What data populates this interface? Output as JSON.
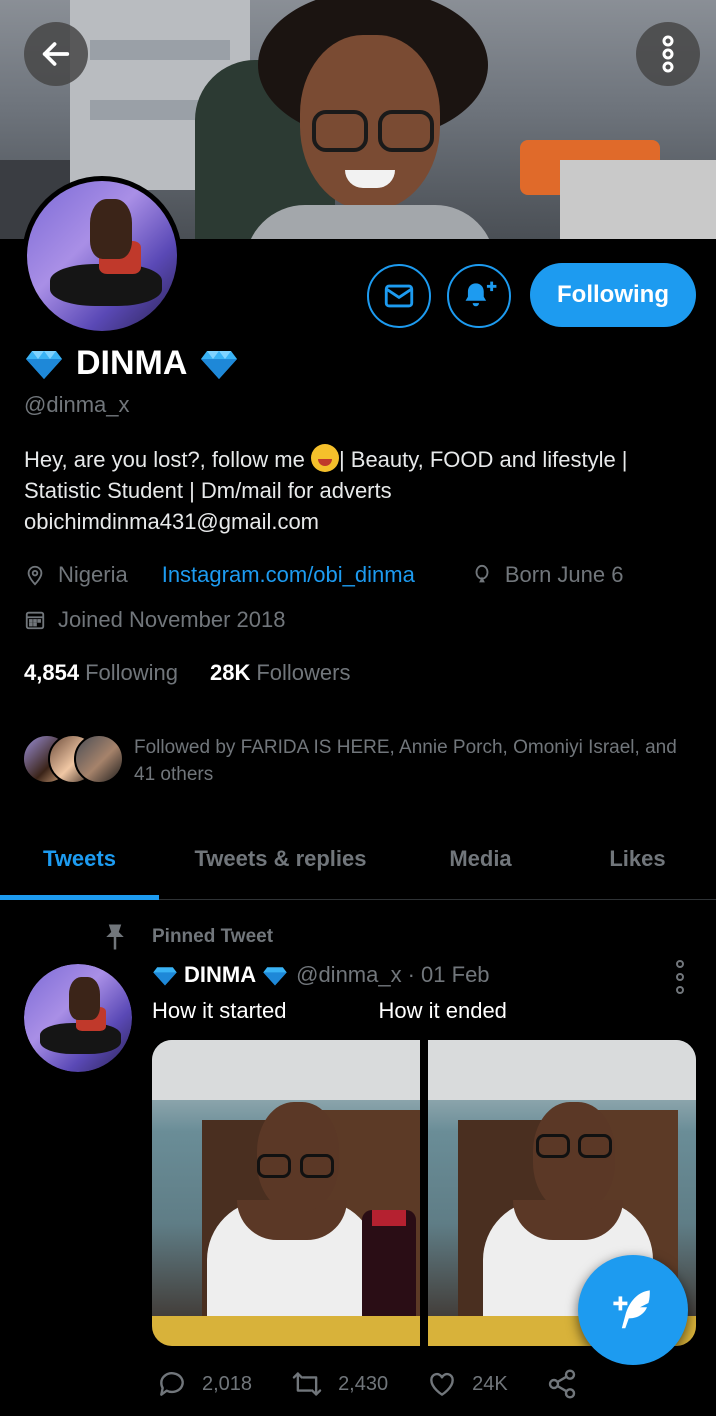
{
  "header": {
    "back_icon": "arrow-left-icon",
    "more_icon": "more-vertical-icon"
  },
  "profile": {
    "display_name": "DINMA",
    "handle": "@dinma_x",
    "bio": "Hey, are you lost?, follow me 🤪| Beauty, FOOD and lifestyle | Statistic Student | Dm/mail for adverts obichimdinma431@gmail.com",
    "bio_before_emoji": "Hey, are you lost?, follow me ",
    "bio_after_emoji": "| Beauty, FOOD and lifestyle | Statistic Student | Dm/mail for adverts obichimdinma431@gmail.com",
    "location": "Nigeria",
    "website": "Instagram.com/obi_dinma",
    "birthday": "Born June 6",
    "joined": "Joined November 2018",
    "following_count": "4,854",
    "following_label": "Following",
    "followers_count": "28K",
    "followers_label": "Followers",
    "followed_by": "Followed by FARIDA IS HERE, Annie Porch, Omoniyi Israel, and 41 others"
  },
  "actions": {
    "message_icon": "mail-icon",
    "notify_icon": "bell-plus-icon",
    "follow_label": "Following"
  },
  "tabs": [
    {
      "label": "Tweets",
      "active": true
    },
    {
      "label": "Tweets & replies",
      "active": false
    },
    {
      "label": "Media",
      "active": false
    },
    {
      "label": "Likes",
      "active": false
    }
  ],
  "pinned_tweet": {
    "pinned_label": "Pinned Tweet",
    "name": "DINMA",
    "handle": "@dinma_x",
    "date": "· 01 Feb",
    "text_left": "How it started",
    "text_right": "How it ended",
    "replies": "2,018",
    "retweets": "2,430",
    "likes": "24K"
  },
  "colors": {
    "accent": "#1d9bf0",
    "background": "#000000",
    "muted": "#71767b"
  }
}
